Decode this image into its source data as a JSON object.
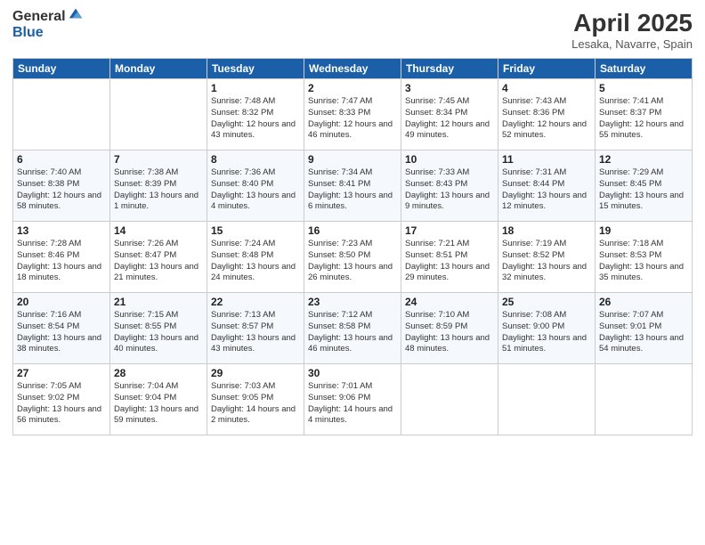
{
  "logo": {
    "general": "General",
    "blue": "Blue"
  },
  "header": {
    "title": "April 2025",
    "location": "Lesaka, Navarre, Spain"
  },
  "days_of_week": [
    "Sunday",
    "Monday",
    "Tuesday",
    "Wednesday",
    "Thursday",
    "Friday",
    "Saturday"
  ],
  "weeks": [
    [
      {
        "day": "",
        "sunrise": "",
        "sunset": "",
        "daylight": ""
      },
      {
        "day": "",
        "sunrise": "",
        "sunset": "",
        "daylight": ""
      },
      {
        "day": "1",
        "sunrise": "Sunrise: 7:48 AM",
        "sunset": "Sunset: 8:32 PM",
        "daylight": "Daylight: 12 hours and 43 minutes."
      },
      {
        "day": "2",
        "sunrise": "Sunrise: 7:47 AM",
        "sunset": "Sunset: 8:33 PM",
        "daylight": "Daylight: 12 hours and 46 minutes."
      },
      {
        "day": "3",
        "sunrise": "Sunrise: 7:45 AM",
        "sunset": "Sunset: 8:34 PM",
        "daylight": "Daylight: 12 hours and 49 minutes."
      },
      {
        "day": "4",
        "sunrise": "Sunrise: 7:43 AM",
        "sunset": "Sunset: 8:36 PM",
        "daylight": "Daylight: 12 hours and 52 minutes."
      },
      {
        "day": "5",
        "sunrise": "Sunrise: 7:41 AM",
        "sunset": "Sunset: 8:37 PM",
        "daylight": "Daylight: 12 hours and 55 minutes."
      }
    ],
    [
      {
        "day": "6",
        "sunrise": "Sunrise: 7:40 AM",
        "sunset": "Sunset: 8:38 PM",
        "daylight": "Daylight: 12 hours and 58 minutes."
      },
      {
        "day": "7",
        "sunrise": "Sunrise: 7:38 AM",
        "sunset": "Sunset: 8:39 PM",
        "daylight": "Daylight: 13 hours and 1 minute."
      },
      {
        "day": "8",
        "sunrise": "Sunrise: 7:36 AM",
        "sunset": "Sunset: 8:40 PM",
        "daylight": "Daylight: 13 hours and 4 minutes."
      },
      {
        "day": "9",
        "sunrise": "Sunrise: 7:34 AM",
        "sunset": "Sunset: 8:41 PM",
        "daylight": "Daylight: 13 hours and 6 minutes."
      },
      {
        "day": "10",
        "sunrise": "Sunrise: 7:33 AM",
        "sunset": "Sunset: 8:43 PM",
        "daylight": "Daylight: 13 hours and 9 minutes."
      },
      {
        "day": "11",
        "sunrise": "Sunrise: 7:31 AM",
        "sunset": "Sunset: 8:44 PM",
        "daylight": "Daylight: 13 hours and 12 minutes."
      },
      {
        "day": "12",
        "sunrise": "Sunrise: 7:29 AM",
        "sunset": "Sunset: 8:45 PM",
        "daylight": "Daylight: 13 hours and 15 minutes."
      }
    ],
    [
      {
        "day": "13",
        "sunrise": "Sunrise: 7:28 AM",
        "sunset": "Sunset: 8:46 PM",
        "daylight": "Daylight: 13 hours and 18 minutes."
      },
      {
        "day": "14",
        "sunrise": "Sunrise: 7:26 AM",
        "sunset": "Sunset: 8:47 PM",
        "daylight": "Daylight: 13 hours and 21 minutes."
      },
      {
        "day": "15",
        "sunrise": "Sunrise: 7:24 AM",
        "sunset": "Sunset: 8:48 PM",
        "daylight": "Daylight: 13 hours and 24 minutes."
      },
      {
        "day": "16",
        "sunrise": "Sunrise: 7:23 AM",
        "sunset": "Sunset: 8:50 PM",
        "daylight": "Daylight: 13 hours and 26 minutes."
      },
      {
        "day": "17",
        "sunrise": "Sunrise: 7:21 AM",
        "sunset": "Sunset: 8:51 PM",
        "daylight": "Daylight: 13 hours and 29 minutes."
      },
      {
        "day": "18",
        "sunrise": "Sunrise: 7:19 AM",
        "sunset": "Sunset: 8:52 PM",
        "daylight": "Daylight: 13 hours and 32 minutes."
      },
      {
        "day": "19",
        "sunrise": "Sunrise: 7:18 AM",
        "sunset": "Sunset: 8:53 PM",
        "daylight": "Daylight: 13 hours and 35 minutes."
      }
    ],
    [
      {
        "day": "20",
        "sunrise": "Sunrise: 7:16 AM",
        "sunset": "Sunset: 8:54 PM",
        "daylight": "Daylight: 13 hours and 38 minutes."
      },
      {
        "day": "21",
        "sunrise": "Sunrise: 7:15 AM",
        "sunset": "Sunset: 8:55 PM",
        "daylight": "Daylight: 13 hours and 40 minutes."
      },
      {
        "day": "22",
        "sunrise": "Sunrise: 7:13 AM",
        "sunset": "Sunset: 8:57 PM",
        "daylight": "Daylight: 13 hours and 43 minutes."
      },
      {
        "day": "23",
        "sunrise": "Sunrise: 7:12 AM",
        "sunset": "Sunset: 8:58 PM",
        "daylight": "Daylight: 13 hours and 46 minutes."
      },
      {
        "day": "24",
        "sunrise": "Sunrise: 7:10 AM",
        "sunset": "Sunset: 8:59 PM",
        "daylight": "Daylight: 13 hours and 48 minutes."
      },
      {
        "day": "25",
        "sunrise": "Sunrise: 7:08 AM",
        "sunset": "Sunset: 9:00 PM",
        "daylight": "Daylight: 13 hours and 51 minutes."
      },
      {
        "day": "26",
        "sunrise": "Sunrise: 7:07 AM",
        "sunset": "Sunset: 9:01 PM",
        "daylight": "Daylight: 13 hours and 54 minutes."
      }
    ],
    [
      {
        "day": "27",
        "sunrise": "Sunrise: 7:05 AM",
        "sunset": "Sunset: 9:02 PM",
        "daylight": "Daylight: 13 hours and 56 minutes."
      },
      {
        "day": "28",
        "sunrise": "Sunrise: 7:04 AM",
        "sunset": "Sunset: 9:04 PM",
        "daylight": "Daylight: 13 hours and 59 minutes."
      },
      {
        "day": "29",
        "sunrise": "Sunrise: 7:03 AM",
        "sunset": "Sunset: 9:05 PM",
        "daylight": "Daylight: 14 hours and 2 minutes."
      },
      {
        "day": "30",
        "sunrise": "Sunrise: 7:01 AM",
        "sunset": "Sunset: 9:06 PM",
        "daylight": "Daylight: 14 hours and 4 minutes."
      },
      {
        "day": "",
        "sunrise": "",
        "sunset": "",
        "daylight": ""
      },
      {
        "day": "",
        "sunrise": "",
        "sunset": "",
        "daylight": ""
      },
      {
        "day": "",
        "sunrise": "",
        "sunset": "",
        "daylight": ""
      }
    ]
  ]
}
